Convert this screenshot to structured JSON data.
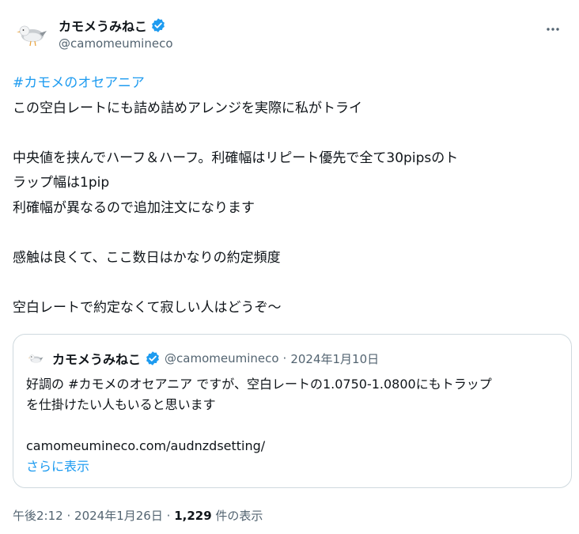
{
  "tweet": {
    "author": {
      "display_name": "カモメうみねこ",
      "handle": "@camomeumineco",
      "verified": true,
      "avatar_icon": "seagull-avatar"
    },
    "lines": [
      {
        "text": "#カモメのオセアニア",
        "hashtag": true
      },
      {
        "text": "この空白レートにも詰め詰めアレンジを実際に私がトライ"
      },
      {
        "text": ""
      },
      {
        "text": "中央値を挟んでハーフ＆ハーフ。利確幅はリピート優先で全て30pipsのト"
      },
      {
        "text": "ラップ幅は1pip"
      },
      {
        "text": "利確幅が異なるので追加注文になります"
      },
      {
        "text": ""
      },
      {
        "text": "感触は良くて、ここ数日はかなりの約定頻度"
      },
      {
        "text": ""
      },
      {
        "text": "空白レートで約定なくて寂しい人はどうぞ～"
      }
    ],
    "quoted": {
      "display_name": "カモメうみねこ",
      "handle": "@camomeumineco",
      "separator": "·",
      "date": "2024年1月10日",
      "text_line1_prefix": "好調の ",
      "text_line1_hashtag": "#カモメのオセアニア",
      "text_line1_suffix": " ですが、空白レートの1.0750-1.0800にもトラップ",
      "text_line2": "を仕掛けたい人もいると思います",
      "link": "camomeumineco.com/audnzdsetting/",
      "show_more": "さらに表示"
    },
    "meta": {
      "time": "午後2:12",
      "sep1": "·",
      "date": "2024年1月26日",
      "sep2": "·",
      "views_count": "1,229",
      "views_label": "件の表示"
    }
  },
  "colors": {
    "accent": "#1d9bf0",
    "text": "#0f1419",
    "muted": "#536471",
    "border": "#cfd9de"
  }
}
